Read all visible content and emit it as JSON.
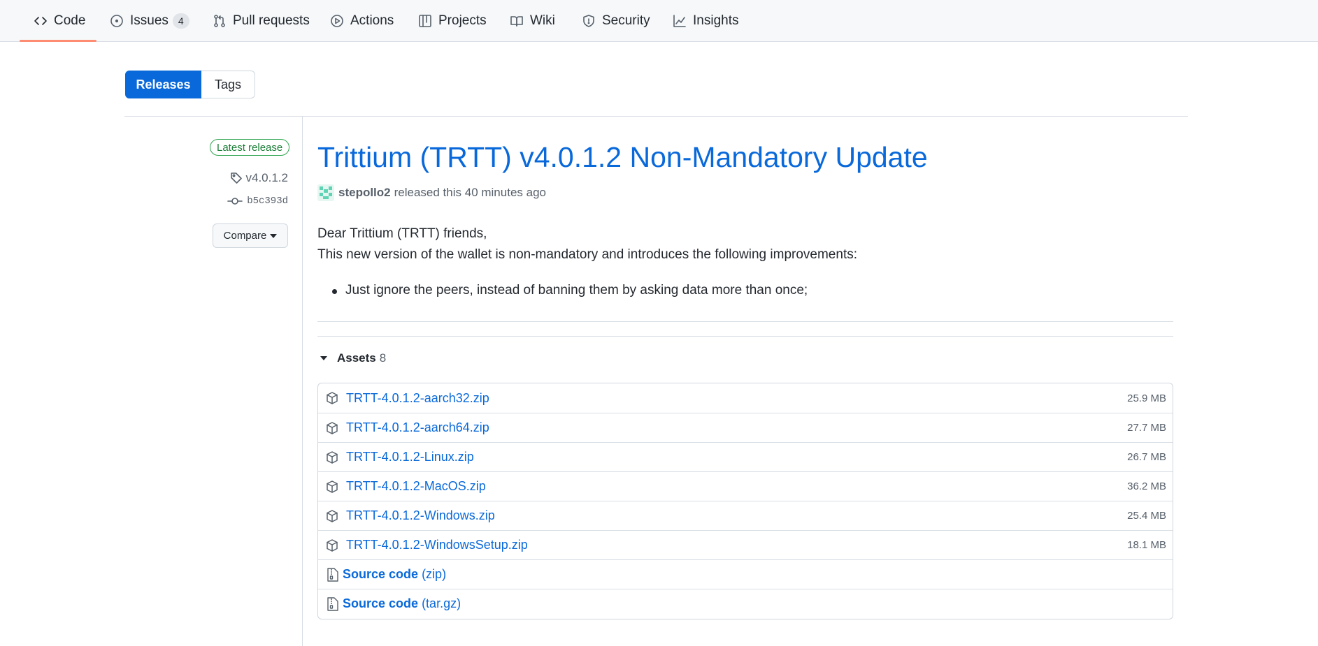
{
  "nav": {
    "tabs": [
      {
        "label": "Code",
        "icon": "code-icon",
        "active": true
      },
      {
        "label": "Issues",
        "icon": "issue-opened-icon",
        "counter": "4"
      },
      {
        "label": "Pull requests",
        "icon": "git-pull-request-icon"
      },
      {
        "label": "Actions",
        "icon": "play-icon"
      },
      {
        "label": "Projects",
        "icon": "table-icon"
      },
      {
        "label": "Wiki",
        "icon": "book-icon"
      },
      {
        "label": "Security",
        "icon": "shield-icon"
      },
      {
        "label": "Insights",
        "icon": "graph-icon"
      }
    ],
    "active_color": "#fd8c73"
  },
  "subnav": {
    "releases_label": "Releases",
    "tags_label": "Tags"
  },
  "sidebar": {
    "badge": "Latest release",
    "tag": "v4.0.1.2",
    "commit": "b5c393d",
    "compare_label": "Compare"
  },
  "release": {
    "title": "Trittium (TRTT) v4.0.1.2 Non-Mandatory Update",
    "author": "stepollo2",
    "released_text": "released this 40 minutes ago",
    "greeting": "Dear Trittium (TRTT) friends,",
    "intro": "This new version of the wallet is non-mandatory and introduces the following improvements:",
    "bullets": [
      "Just ignore the peers, instead of banning them by asking data more than once;"
    ]
  },
  "assets": {
    "label": "Assets",
    "count": "8",
    "files": [
      {
        "name": "TRTT-4.0.1.2-aarch32.zip",
        "size": "25.9 MB"
      },
      {
        "name": "TRTT-4.0.1.2-aarch64.zip",
        "size": "27.7 MB"
      },
      {
        "name": "TRTT-4.0.1.2-Linux.zip",
        "size": "26.7 MB"
      },
      {
        "name": "TRTT-4.0.1.2-MacOS.zip",
        "size": "36.2 MB"
      },
      {
        "name": "TRTT-4.0.1.2-Windows.zip",
        "size": "25.4 MB"
      },
      {
        "name": "TRTT-4.0.1.2-WindowsSetup.zip",
        "size": "18.1 MB"
      }
    ],
    "source": [
      {
        "label": "Source code",
        "format": "(zip)"
      },
      {
        "label": "Source code",
        "format": "(tar.gz)"
      }
    ]
  },
  "colors": {
    "accent": "#0969da",
    "badge_green": "#1a7f37",
    "border": "#d0d7de"
  }
}
